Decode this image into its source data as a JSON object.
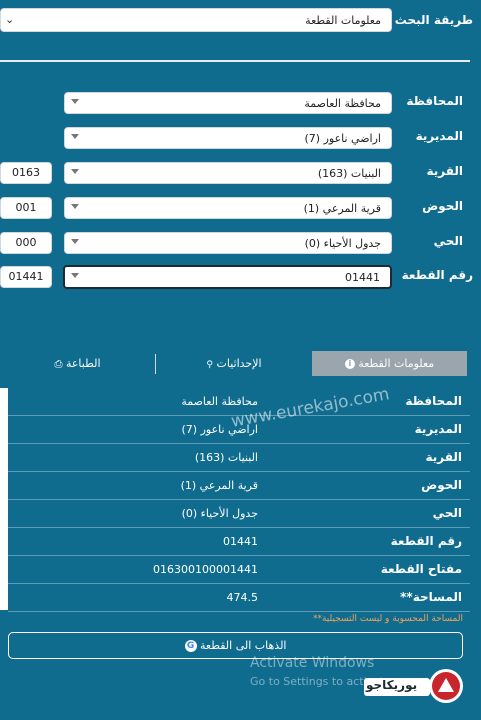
{
  "search": {
    "label": "طريقة البحث",
    "value": "معلومات القطعة"
  },
  "form": {
    "fields": [
      {
        "label": "المحافظة",
        "value": "محافظة العاصمة",
        "code": ""
      },
      {
        "label": "المديرية",
        "value": "اراضي ناعور (7)",
        "code": ""
      },
      {
        "label": "القرية",
        "value": "البنيات (163)",
        "code": "0163"
      },
      {
        "label": "الحوض",
        "value": "قرية المرعي (1)",
        "code": "001"
      },
      {
        "label": "الحي",
        "value": "جدول الأحياء (0)",
        "code": "000"
      },
      {
        "label": "رقم القطعة",
        "value": "01441",
        "code": "01441"
      }
    ]
  },
  "tabs": [
    {
      "label": "معلومات القطعة",
      "icon": "info-icon"
    },
    {
      "label": "الإحداثيات",
      "icon": "location-pin-icon"
    },
    {
      "label": "الطباعة",
      "icon": "printer-icon"
    }
  ],
  "details": [
    {
      "key": "المحافظة",
      "value": "محافظة العاصمة"
    },
    {
      "key": "المديرية",
      "value": "اراضي ناعور (7)"
    },
    {
      "key": "القرية",
      "value": "البنيات (163)"
    },
    {
      "key": "الحوض",
      "value": "قرية المرعي (1)"
    },
    {
      "key": "الحي",
      "value": "جدول الأحياء (0)"
    },
    {
      "key": "رقم القطعة",
      "value": "01441"
    },
    {
      "key": "مفتاح القطعة",
      "value": "016300100001441"
    },
    {
      "key": "**المساحة",
      "value": "474.5"
    }
  ],
  "note": "**المساحة المحسوبة و ليست التسجيلية",
  "goto_label": "الذهاب الى القطعة",
  "watermark_site": "www.eurekajo.com",
  "windows": {
    "line1": "Activate Windows",
    "line2": "Go to Settings to activate"
  },
  "brand": {
    "logo_text": "يوريكاجو"
  },
  "colors": {
    "background": "#0f6c8f",
    "accent_note": "#f0a35a",
    "tab_active": "#9aa5ad"
  }
}
